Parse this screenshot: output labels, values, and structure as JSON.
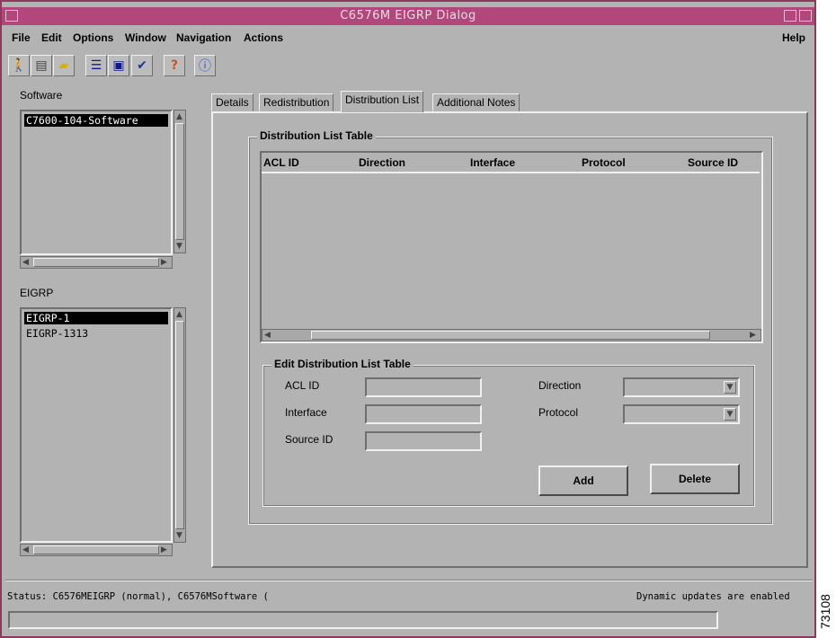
{
  "window": {
    "title": "C6576M EIGRP Dialog"
  },
  "menu": {
    "file": "File",
    "edit": "Edit",
    "options": "Options",
    "window": "Window",
    "navigation": "Navigation",
    "actions": "Actions",
    "help": "Help"
  },
  "toolbar": {
    "icons": [
      "exit-icon",
      "print-icon",
      "open-folder-icon",
      "list-icon",
      "monitor-icon",
      "checkmark-icon",
      "help-icon",
      "info-icon"
    ]
  },
  "software": {
    "label": "Software",
    "items": [
      "C7600-104-Software"
    ]
  },
  "eigrp": {
    "label": "EIGRP",
    "items": [
      "EIGRP-1",
      "EIGRP-1313"
    ]
  },
  "tabs": [
    "Details",
    "Redistribution",
    "Distribution List",
    "Additional Notes"
  ],
  "dist_table": {
    "title": "Distribution List Table",
    "columns": [
      "ACL ID",
      "Direction",
      "Interface",
      "Protocol",
      "Source ID"
    ],
    "rows": []
  },
  "edit": {
    "title": "Edit Distribution List Table",
    "acl_label": "ACL ID",
    "acl_value": "",
    "interface_label": "Interface",
    "interface_value": "",
    "source_label": "Source ID",
    "source_value": "",
    "direction_label": "Direction",
    "direction_value": "",
    "protocol_label": "Protocol",
    "protocol_value": "",
    "add": "Add",
    "delete": "Delete"
  },
  "status": {
    "text": "Status: C6576MEIGRP (normal), C6576MSoftware (",
    "right": "Dynamic updates are enabled"
  },
  "side_code": "73108"
}
